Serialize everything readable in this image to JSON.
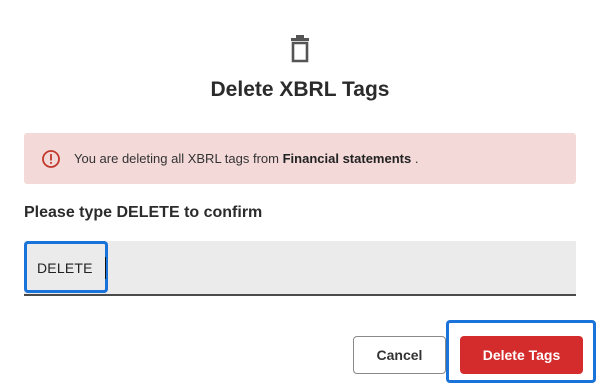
{
  "dialog": {
    "icon": "trash-icon",
    "title": "Delete XBRL Tags"
  },
  "alert": {
    "icon": "alert-circle-icon",
    "text_before": "You are deleting all XBRL tags from ",
    "emphasis": "Financial statements",
    "text_after": " .",
    "background_color": "#f4d9d9",
    "icon_color": "#c0392b"
  },
  "confirm": {
    "label": "Please type DELETE to confirm",
    "input_value": "DELETE"
  },
  "buttons": {
    "cancel_label": "Cancel",
    "delete_label": "Delete Tags",
    "delete_color": "#d42c2c"
  },
  "focus_color": "#1a73d9"
}
